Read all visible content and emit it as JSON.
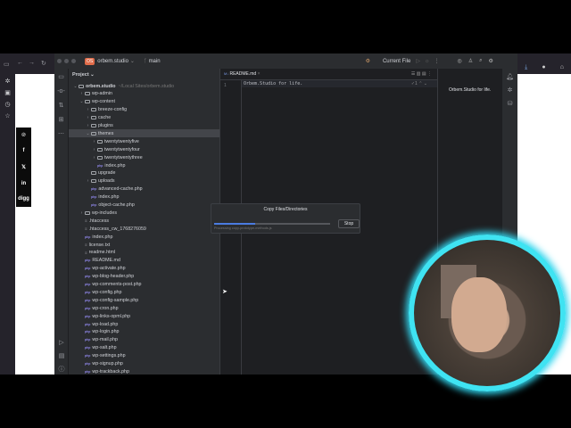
{
  "browser": {
    "social": [
      "℗",
      "f",
      "𝕏",
      "in",
      "digg"
    ]
  },
  "ide": {
    "project_name": "orbem.studio",
    "project_badge": "OS",
    "branch": "main",
    "run_config": "Current File",
    "panel_title": "Project",
    "tree": [
      {
        "name": "orbem.studio",
        "depth": 0,
        "type": "root",
        "expanded": true,
        "hint": "~/Local Sites/orbem.studio"
      },
      {
        "name": "wp-admin",
        "depth": 1,
        "type": "folder",
        "expanded": false
      },
      {
        "name": "wp-content",
        "depth": 1,
        "type": "folder",
        "expanded": true
      },
      {
        "name": "breeze-config",
        "depth": 2,
        "type": "folder",
        "expanded": false
      },
      {
        "name": "cache",
        "depth": 2,
        "type": "folder",
        "expanded": false
      },
      {
        "name": "plugins",
        "depth": 2,
        "type": "folder",
        "expanded": false
      },
      {
        "name": "themes",
        "depth": 2,
        "type": "folder",
        "expanded": true,
        "selected": true
      },
      {
        "name": "twentytwentyfive",
        "depth": 3,
        "type": "folder",
        "expanded": false
      },
      {
        "name": "twentytwentyfour",
        "depth": 3,
        "type": "folder",
        "expanded": false
      },
      {
        "name": "twentytwentythree",
        "depth": 3,
        "type": "folder",
        "expanded": false
      },
      {
        "name": "index.php",
        "depth": 3,
        "type": "php"
      },
      {
        "name": "upgrade",
        "depth": 2,
        "type": "folder",
        "leaf": true
      },
      {
        "name": "uploads",
        "depth": 2,
        "type": "folder",
        "expanded": false
      },
      {
        "name": "advanced-cache.php",
        "depth": 2,
        "type": "php"
      },
      {
        "name": "index.php",
        "depth": 2,
        "type": "php"
      },
      {
        "name": "object-cache.php",
        "depth": 2,
        "type": "php"
      },
      {
        "name": "wp-includes",
        "depth": 1,
        "type": "folder",
        "expanded": false
      },
      {
        "name": ".htaccess",
        "depth": 1,
        "type": "file"
      },
      {
        "name": ".htaccess_cw_1768276059",
        "depth": 1,
        "type": "file"
      },
      {
        "name": "index.php",
        "depth": 1,
        "type": "php"
      },
      {
        "name": "license.txt",
        "depth": 1,
        "type": "file"
      },
      {
        "name": "readme.html",
        "depth": 1,
        "type": "file"
      },
      {
        "name": "README.md",
        "depth": 1,
        "type": "php"
      },
      {
        "name": "wp-activate.php",
        "depth": 1,
        "type": "php"
      },
      {
        "name": "wp-blog-header.php",
        "depth": 1,
        "type": "php"
      },
      {
        "name": "wp-comments-post.php",
        "depth": 1,
        "type": "php"
      },
      {
        "name": "wp-config.php",
        "depth": 1,
        "type": "php"
      },
      {
        "name": "wp-config-sample.php",
        "depth": 1,
        "type": "php"
      },
      {
        "name": "wp-cron.php",
        "depth": 1,
        "type": "php"
      },
      {
        "name": "wp-links-opml.php",
        "depth": 1,
        "type": "php"
      },
      {
        "name": "wp-load.php",
        "depth": 1,
        "type": "php"
      },
      {
        "name": "wp-login.php",
        "depth": 1,
        "type": "php"
      },
      {
        "name": "wp-mail.php",
        "depth": 1,
        "type": "php"
      },
      {
        "name": "wp-salt.php",
        "depth": 1,
        "type": "php"
      },
      {
        "name": "wp-settings.php",
        "depth": 1,
        "type": "php"
      },
      {
        "name": "wp-signup.php",
        "depth": 1,
        "type": "php"
      },
      {
        "name": "wp-trackback.php",
        "depth": 1,
        "type": "php"
      }
    ],
    "editor": {
      "tab": "README.md",
      "line_no": "1",
      "line": "Orbem.Studio for life.",
      "inspect": "✓1",
      "preview": "Orbem.Studio for life."
    },
    "dialog": {
      "title": "Copy Files/Directories",
      "progress": 0.35,
      "status": "Processing copy-prototype-methods.js",
      "stop": "Stop"
    }
  }
}
